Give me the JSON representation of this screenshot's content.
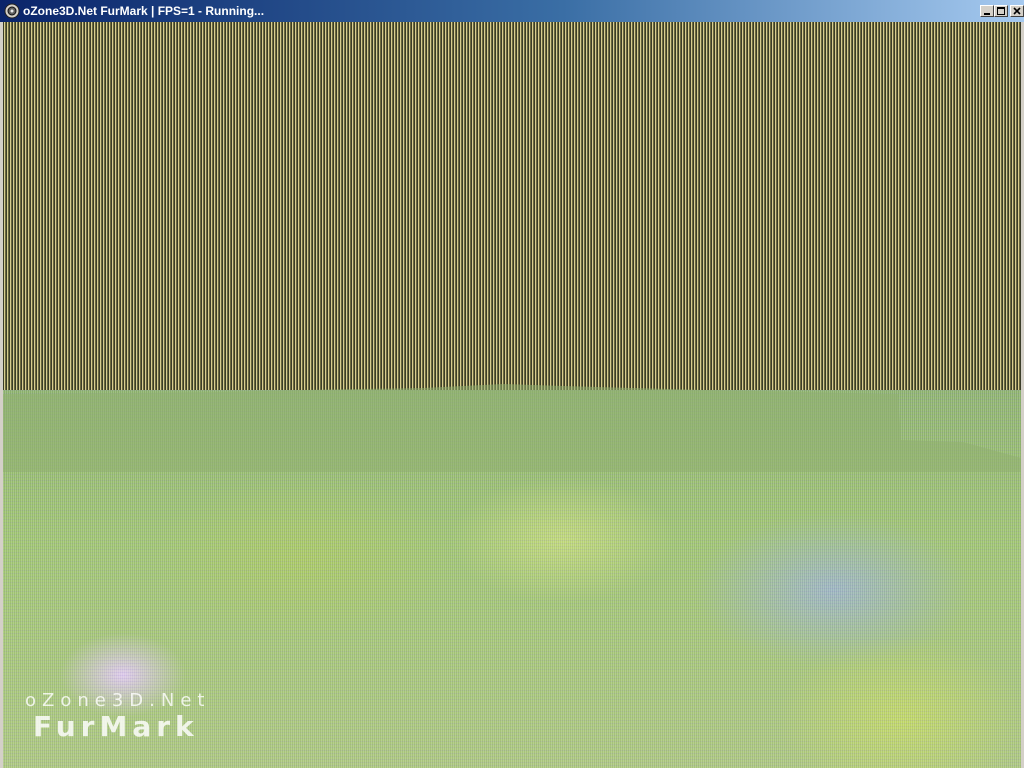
{
  "window": {
    "title": "oZone3D.Net FurMark | FPS=1 - Running...",
    "buttons": {
      "minimize": "minimize",
      "maximize": "maximize",
      "close": "close"
    }
  },
  "viewport": {
    "watermark_line1": "oZone3D.Net",
    "watermark_line2": "FurMark"
  },
  "icons": {
    "app": "app-icon",
    "minimize": "minimize-icon",
    "maximize": "maximize-icon",
    "close": "close-icon"
  },
  "colors": {
    "titlebar_start": "#0a246a",
    "titlebar_end": "#a6caf0",
    "frame": "#d4d0c8"
  }
}
